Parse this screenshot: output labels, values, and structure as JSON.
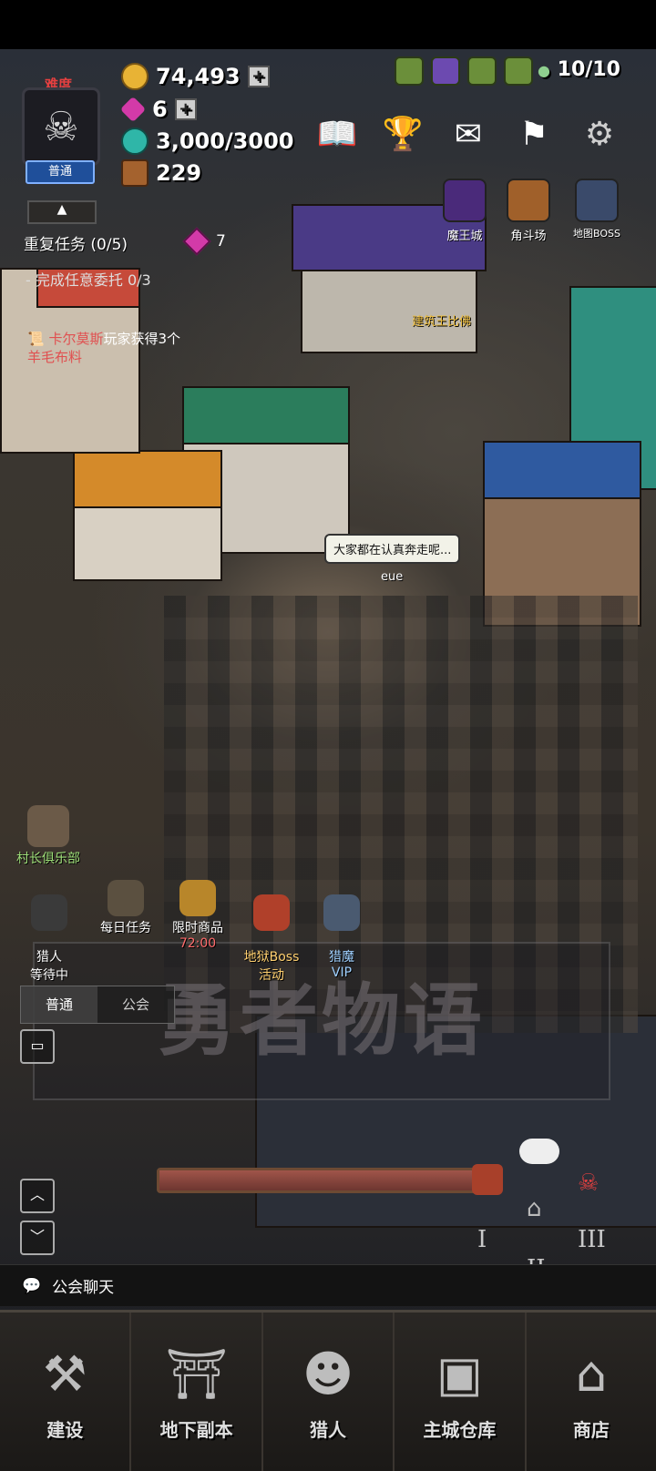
{
  "hud": {
    "difficulty_label": "难度",
    "difficulty_mode": "普通",
    "gold": "74,493",
    "gems": "6",
    "energy": "3,000/3000",
    "chests": "229",
    "population": "10/10"
  },
  "destinations": [
    {
      "label": "魔王城",
      "icon": "demon-castle-icon"
    },
    {
      "label": "角斗场",
      "icon": "arena-icon"
    },
    {
      "label": "地图BOSS",
      "icon": "map-boss-icon"
    }
  ],
  "quest": {
    "title": "重复任务 (0/5)",
    "reward": "7",
    "item": "-  完成任意委托 0/3"
  },
  "notice": {
    "who": "卡尔莫斯",
    "text": "玩家获得3个",
    "item": "羊毛布料"
  },
  "world": {
    "bubble": "大家都在认真奔走呢...",
    "player_name": "eue",
    "npc_label": "建筑王比佛",
    "watermark": "勇者物语"
  },
  "side_buttons": {
    "village_club": "村长俱乐部",
    "hunter_waiting": "猎人\n等待中",
    "daily_task": "每日任务",
    "limited_goods": "限时商品",
    "limited_time": "72:00",
    "hell_boss": "地狱Boss\n活动",
    "hunt_vip": "猎魔\nVIP"
  },
  "chat": {
    "tab_normal": "普通",
    "tab_guild": "公会",
    "guild_chat_label": "公会聊天"
  },
  "progress": {
    "value": 1.0
  },
  "floors": {
    "f1": "I",
    "f2": "II",
    "f3": "III"
  },
  "nav": [
    {
      "label": "建设",
      "icon": "build-icon"
    },
    {
      "label": "地下副本",
      "icon": "dungeon-icon"
    },
    {
      "label": "猎人",
      "icon": "hunter-icon"
    },
    {
      "label": "主城仓库",
      "icon": "warehouse-icon"
    },
    {
      "label": "商店",
      "icon": "shop-icon"
    }
  ],
  "colors": {
    "gold": "#e8b335",
    "gem": "#d33aa8",
    "energy": "#2fb6a8",
    "difficulty": "#e54040"
  }
}
